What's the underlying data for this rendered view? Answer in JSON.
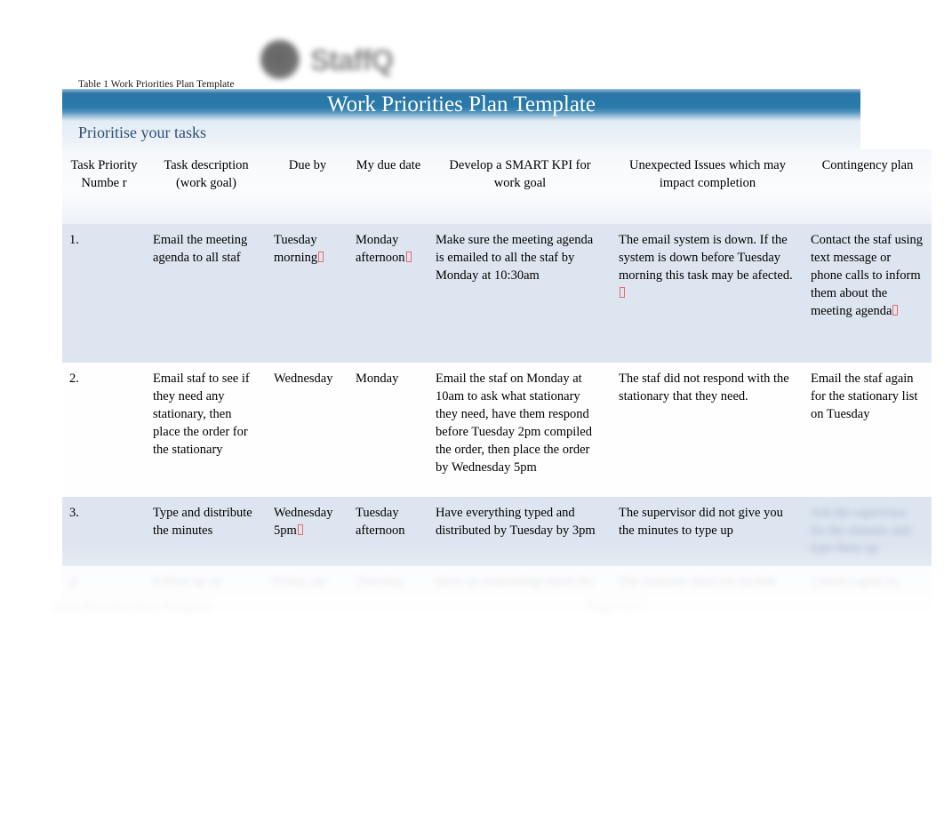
{
  "logo": {
    "wordmark": "StaffQ",
    "mark_icon": "circle-logo-mark"
  },
  "caption": "Table 1 Work Priorities Plan Template",
  "document": {
    "title": "Work Priorities Plan Template",
    "subtitle": "Prioritise your tasks"
  },
  "colors": {
    "title_bar_blue": "#2878a9",
    "subtitle_text": "#2d4f72",
    "row_shade": "#dde5f0",
    "missing_glyph_red": "#e86a6a"
  },
  "table": {
    "headers": [
      "Task Priority Numbe r",
      "Task description (work goal)",
      "Due by",
      "My due date",
      "Develop a SMART KPI for work goal",
      "Unexpected Issues which may impact completion",
      "Contingency plan"
    ],
    "rows": [
      {
        "number": "1.",
        "task_description": "Email the meeting agenda to all staf",
        "due_by": "Tuesday morning",
        "due_by_tofu": true,
        "my_due_date": "Monday afternoon",
        "my_due_date_tofu": true,
        "smart_kpi": "Make sure the meeting agenda is emailed to all the staf by Monday at 10:30am",
        "unexpected_issues": "The email system is down. If the system is down before Tuesday morning this task may be afected.",
        "unexpected_issues_tofu": true,
        "contingency_plan": "Contact the staf using text message or phone calls to inform them about the meeting agenda",
        "contingency_plan_tofu": true,
        "contingency_ghost": false
      },
      {
        "number": "2.",
        "task_description": "Email staf to see if they need any stationary, then place the order for the stationary",
        "due_by": "Wednesday",
        "due_by_tofu": false,
        "my_due_date": "Monday",
        "my_due_date_tofu": false,
        "smart_kpi": "Email the staf on Monday at 10am to ask what stationary they need, have them respond before Tuesday 2pm compiled the order, then place the order by Wednesday 5pm",
        "unexpected_issues": "The staf did not respond with the stationary that they need.",
        "unexpected_issues_tofu": false,
        "contingency_plan": "Email the staf again for the stationary list on Tuesday",
        "contingency_plan_tofu": false,
        "contingency_ghost": false
      },
      {
        "number": "3.",
        "task_description": "Type and distribute the minutes",
        "due_by": "Wednesday 5pm",
        "due_by_tofu": true,
        "my_due_date": "Tuesday afternoon",
        "my_due_date_tofu": false,
        "smart_kpi": "Have everything typed and distributed by Tuesday by 3pm",
        "unexpected_issues": "The supervisor did not give you the minutes to type up",
        "unexpected_issues_tofu": false,
        "contingency_plan": "Ask the supervisor for the minutes and type them up",
        "contingency_plan_tofu": false,
        "contingency_ghost": true
      },
      {
        "number": "4.",
        "task_description": "Follow up on",
        "due_by": "Friday am",
        "due_by_tofu": false,
        "my_due_date": "Thursday",
        "my_due_date_tofu": false,
        "smart_kpi": "Have an outstanding report for",
        "unexpected_issues": "The customer does not include",
        "unexpected_issues_tofu": false,
        "contingency_plan": "Contact again on",
        "contingency_plan_tofu": false,
        "contingency_ghost": true
      }
    ]
  },
  "footer": {
    "left_text": "Work Priorities Plan Template",
    "page_text": "Page 1 of 1"
  }
}
